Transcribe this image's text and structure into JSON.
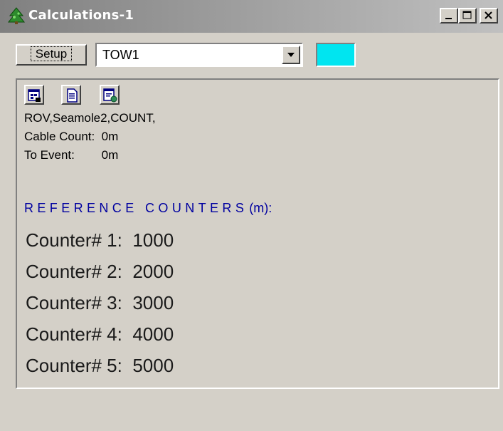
{
  "window": {
    "title": "Calculations-1",
    "controls": {
      "minimize": "_",
      "maximize": "□",
      "close": "×"
    }
  },
  "toolbar": {
    "setup_label": "Setup",
    "tow_select_value": "TOW1",
    "color_swatch": "#00e5f0"
  },
  "icons": [
    "report-icon",
    "document-icon",
    "export-icon"
  ],
  "info": {
    "line1": "ROV,Seamole2,COUNT,",
    "cable_count": "Cable Count:  0m",
    "to_event": "To Event:        0m"
  },
  "reference": {
    "heading": "REFERENCE COUNTERS",
    "unit": "(m):",
    "counters": [
      {
        "label": "Counter# 1:  1000"
      },
      {
        "label": "Counter# 2:  2000"
      },
      {
        "label": "Counter# 3:  3000"
      },
      {
        "label": "Counter# 4:  4000"
      },
      {
        "label": "Counter# 5:  5000"
      }
    ]
  },
  "colors": {
    "title_gradient_start": "#808080",
    "title_gradient_end": "#c0c0c0",
    "heading_blue": "#0000a0",
    "face": "#d4d0c8"
  }
}
